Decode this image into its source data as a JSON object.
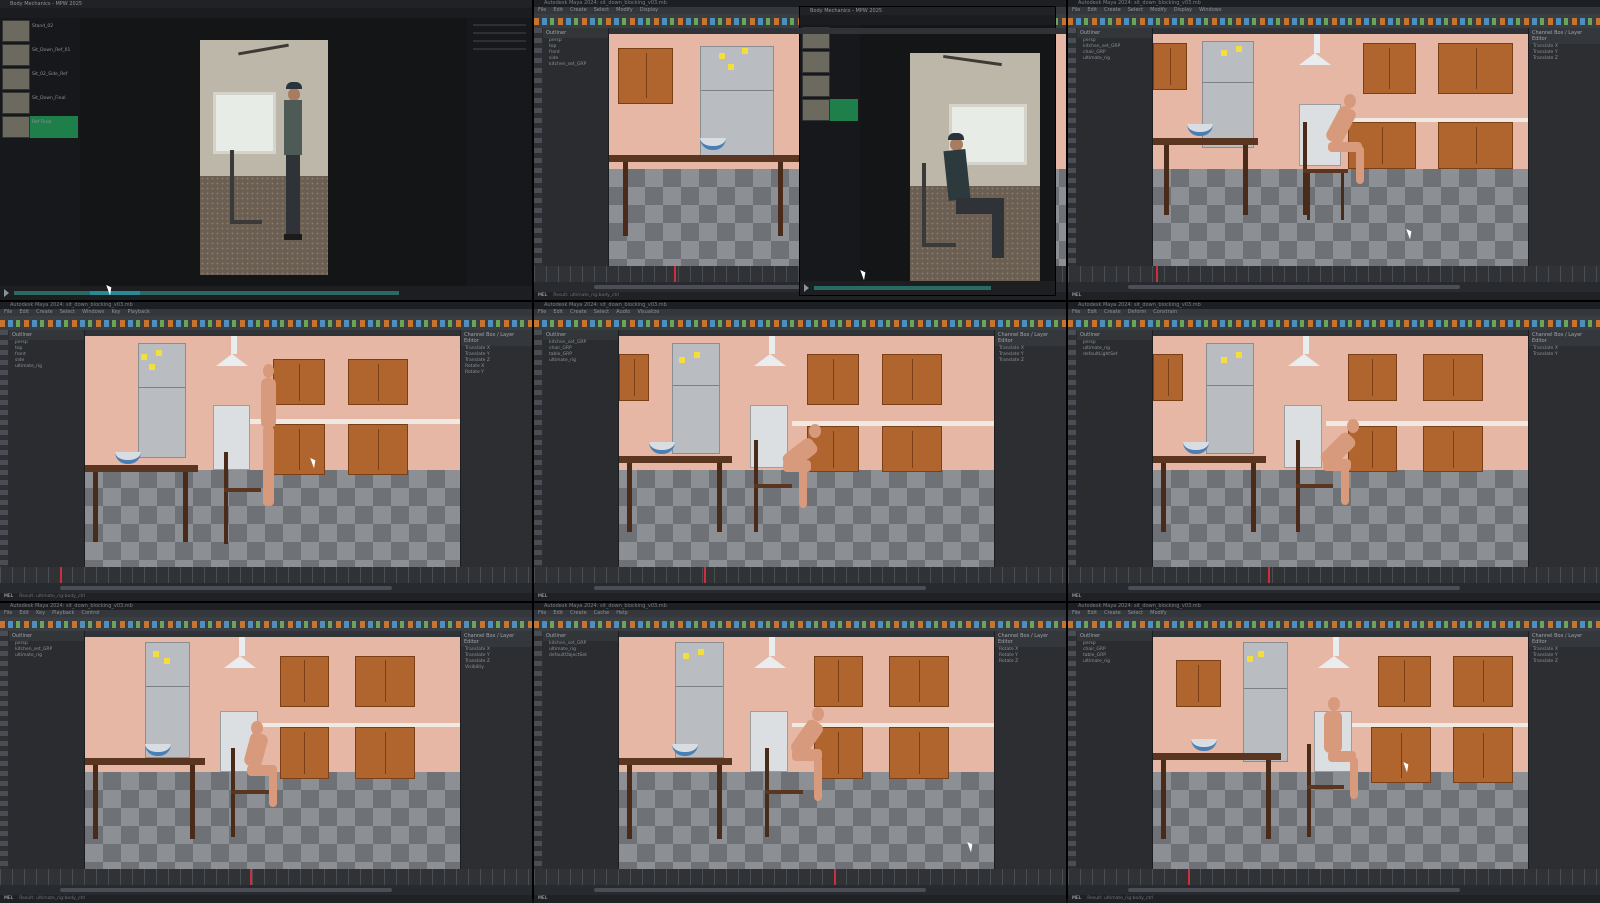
{
  "editor": {
    "window_title": "Body Mechanics - MPW 2025",
    "clips": [
      "Stand_02",
      "Sit_Down_Ref_01",
      "Sit_02_Side_Ref",
      "Sit_Down_Final",
      "Ref Final"
    ],
    "selected_clip": "Ref Final"
  },
  "maya": {
    "window_title": "Autodesk Maya 2024: sit_down_blocking_v03.mb",
    "menu": [
      "File",
      "Edit",
      "Create",
      "Select",
      "Modify",
      "Display",
      "Windows",
      "Key",
      "Playback",
      "Audio",
      "Visualize",
      "Deform",
      "Constrain",
      "Control",
      "Cache",
      "Help"
    ],
    "outliner_title": "Outliner",
    "outliner_items": [
      "persp",
      "top",
      "front",
      "side",
      "kitchen_set_GRP",
      "chair_GRP",
      "table_GRP",
      "ultimate_rig",
      "defaultLightSet",
      "defaultObjectSet"
    ],
    "channelbox_title": "Channel Box / Layer Editor",
    "channels": [
      "Translate X",
      "Translate Y",
      "Translate Z",
      "Rotate X",
      "Rotate Y",
      "Rotate Z",
      "Scale X",
      "Scale Y",
      "Scale Z",
      "Visibility"
    ],
    "cmd_prefix": "MEL",
    "cmd_text": "Result: ultimate_rig:body_ctrl"
  },
  "colors": {
    "accent_selected": "#1e7f4a",
    "playhead": "#c9303b",
    "wall": "#e7b7a6",
    "cabinet": "#b0642e"
  }
}
